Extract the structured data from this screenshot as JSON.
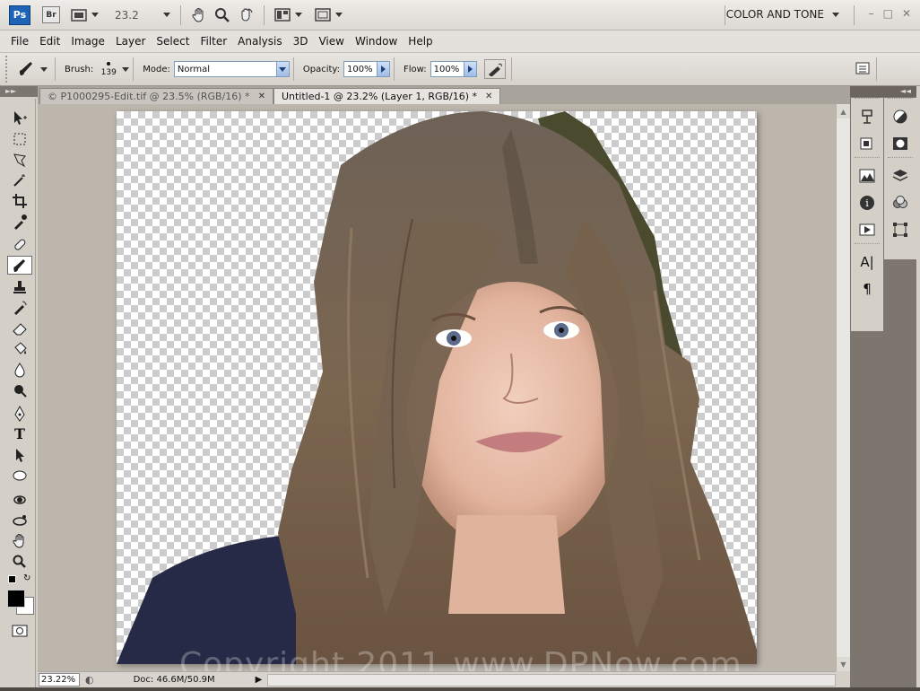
{
  "appbar": {
    "logo": "Ps",
    "bridge": "Br",
    "zoom_value": "23.2",
    "workspace": "COLOR AND TONE"
  },
  "menu": [
    "File",
    "Edit",
    "Image",
    "Layer",
    "Select",
    "Filter",
    "Analysis",
    "3D",
    "View",
    "Window",
    "Help"
  ],
  "options": {
    "brush_label": "Brush:",
    "brush_size": "139",
    "mode_label": "Mode:",
    "mode_value": "Normal",
    "opacity_label": "Opacity:",
    "opacity_value": "100%",
    "flow_label": "Flow:",
    "flow_value": "100%"
  },
  "tabs": [
    {
      "label": "© P1000295-Edit.tif @ 23.5% (RGB/16) *",
      "active": false
    },
    {
      "label": "Untitled-1 @ 23.2% (Layer 1, RGB/16) *",
      "active": true
    }
  ],
  "status": {
    "zoom": "23.22%",
    "doc": "Doc: 46.6M/50.9M"
  },
  "watermark": "Copyright 2011 www.DPNow.com",
  "colors": {
    "foreground": "#000000",
    "background": "#ffffff",
    "ps_blue": "#1e63b5"
  }
}
